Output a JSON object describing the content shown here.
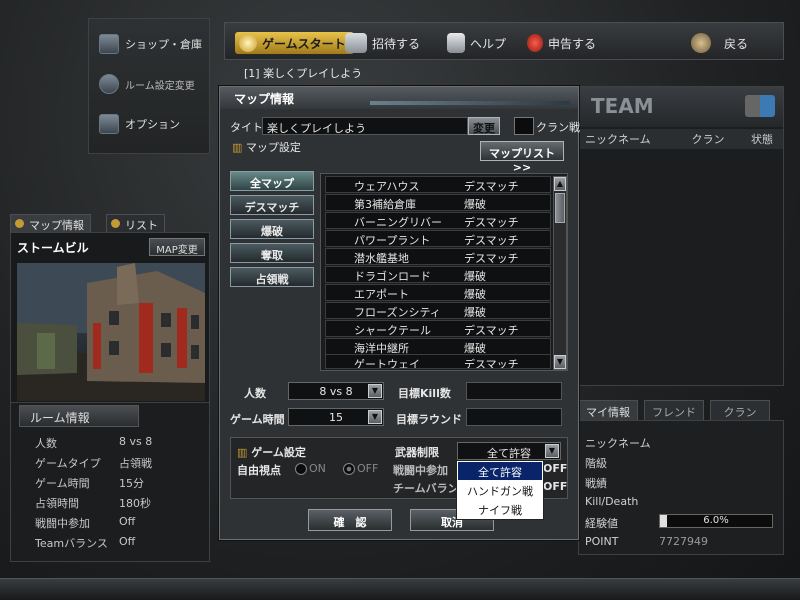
{
  "left_menu": {
    "shop": "ショップ・倉庫",
    "room_settings": "ルーム設定変更",
    "options": "オプション"
  },
  "topbar": {
    "game_start": "ゲームスタート",
    "invite": "招待する",
    "help": "ヘルプ",
    "report": "申告する",
    "back": "戻る"
  },
  "chat_line": "[1] 楽しくプレイしよう",
  "team_panel": {
    "title": "TEAM",
    "col_nickname": "ニックネーム",
    "col_clan": "クラン",
    "col_status": "状態"
  },
  "right_tabs": [
    "マイ情報",
    "フレンド",
    "クラン"
  ],
  "my_info": {
    "nickname_label": "ニックネーム",
    "rank_label": "階級",
    "record_label": "戦績",
    "kd_label": "Kill/Death",
    "exp_label": "経験値",
    "exp_value": "6.0%",
    "exp_fraction": 0.06,
    "point_label": "POINT",
    "point_value": "7727949"
  },
  "left_tabs": [
    "マップ情報",
    "リスト"
  ],
  "map_preview": {
    "name": "ストームビル",
    "change_button": "MAP変更"
  },
  "room_info": {
    "title": "ルーム情報",
    "rows": [
      {
        "label": "人数",
        "value": "8 vs 8"
      },
      {
        "label": "ゲームタイプ",
        "value": "占領戦"
      },
      {
        "label": "ゲーム時間",
        "value": "15分"
      },
      {
        "label": "占領時間",
        "value": "180秒"
      },
      {
        "label": "戦闘中参加",
        "value": "Off"
      },
      {
        "label": "Teamバランス",
        "value": "Off"
      }
    ]
  },
  "dialog": {
    "title": "マップ情報",
    "title_label": "タイトル",
    "title_value": "楽しくプレイしよう",
    "change_button": "変更",
    "clan_war_label": "クラン戦",
    "map_settings_label": "マップ設定",
    "map_list_button": "マップリスト>>",
    "mode_buttons": [
      "全マップ",
      "デスマッチ",
      "爆破",
      "奪取",
      "占領戦"
    ],
    "maps": [
      {
        "name": "ウェアハウス",
        "mode": "デスマッチ"
      },
      {
        "name": "第3補給倉庫",
        "mode": "爆破"
      },
      {
        "name": "バーニングリバー",
        "mode": "デスマッチ"
      },
      {
        "name": "パワープラント",
        "mode": "デスマッチ"
      },
      {
        "name": "潜水艦基地",
        "mode": "デスマッチ"
      },
      {
        "name": "ドラゴンロード",
        "mode": "爆破"
      },
      {
        "name": "エアポート",
        "mode": "爆破"
      },
      {
        "name": "フローズンシティ",
        "mode": "爆破"
      },
      {
        "name": "シャークテール",
        "mode": "デスマッチ"
      },
      {
        "name": "海洋中継所",
        "mode": "爆破"
      },
      {
        "name": "ゲートウェイ",
        "mode": "デスマッチ"
      }
    ],
    "players_label": "人数",
    "players_value": "8 vs 8",
    "target_kill_label": "目標Kill数",
    "game_time_label": "ゲーム時間",
    "game_time_value": "15",
    "target_round_label": "目標ラウンド",
    "game_settings_label": "ゲーム設定",
    "free_view_label": "自由視点",
    "on_label": "ON",
    "off_label": "OFF",
    "weapon_limit_label": "武器制限",
    "weapon_limit_value": "全て許容",
    "mid_join_label": "戦闘中参加",
    "mid_join_off": "OFF",
    "team_balance_label": "チームバランス",
    "team_balance_off": "OFF",
    "confirm_button": "確　認",
    "cancel_button": "取消",
    "weapon_options": [
      "全て許容",
      "ハンドガン戦",
      "ナイフ戦"
    ]
  }
}
